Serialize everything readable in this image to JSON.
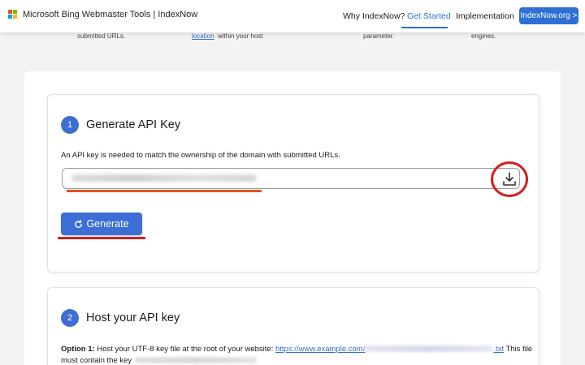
{
  "header": {
    "brand": "Microsoft Bing Webmaster Tools | IndexNow",
    "nav": [
      {
        "label": "Why IndexNow?"
      },
      {
        "label": "Get Started"
      },
      {
        "label": "Implementation"
      }
    ],
    "cta": "IndexNow.org >"
  },
  "strip": {
    "t1": "submitted URLs.",
    "t2": "location",
    "t3": "within your host",
    "t4": "parameter.",
    "t5": "engines."
  },
  "step1": {
    "number": "1",
    "title": "Generate API Key",
    "description": "An API key is needed to match the ownership of the domain with submitted URLs.",
    "generate_label": "Generate"
  },
  "step2": {
    "number": "2",
    "title": "Host your API key",
    "option_label": "Option 1:",
    "option_text": " Host your UTF-8 key file at the root of your website: ",
    "option_link": "https://www.example.com/",
    "option_link_suffix": ".txt",
    "option_tail": " This file",
    "option_line2": "must contain the key"
  },
  "colors": {
    "accent": "#2f6fd3",
    "highlight_red": "#d81e1e",
    "highlight_orange": "#e0541e"
  }
}
